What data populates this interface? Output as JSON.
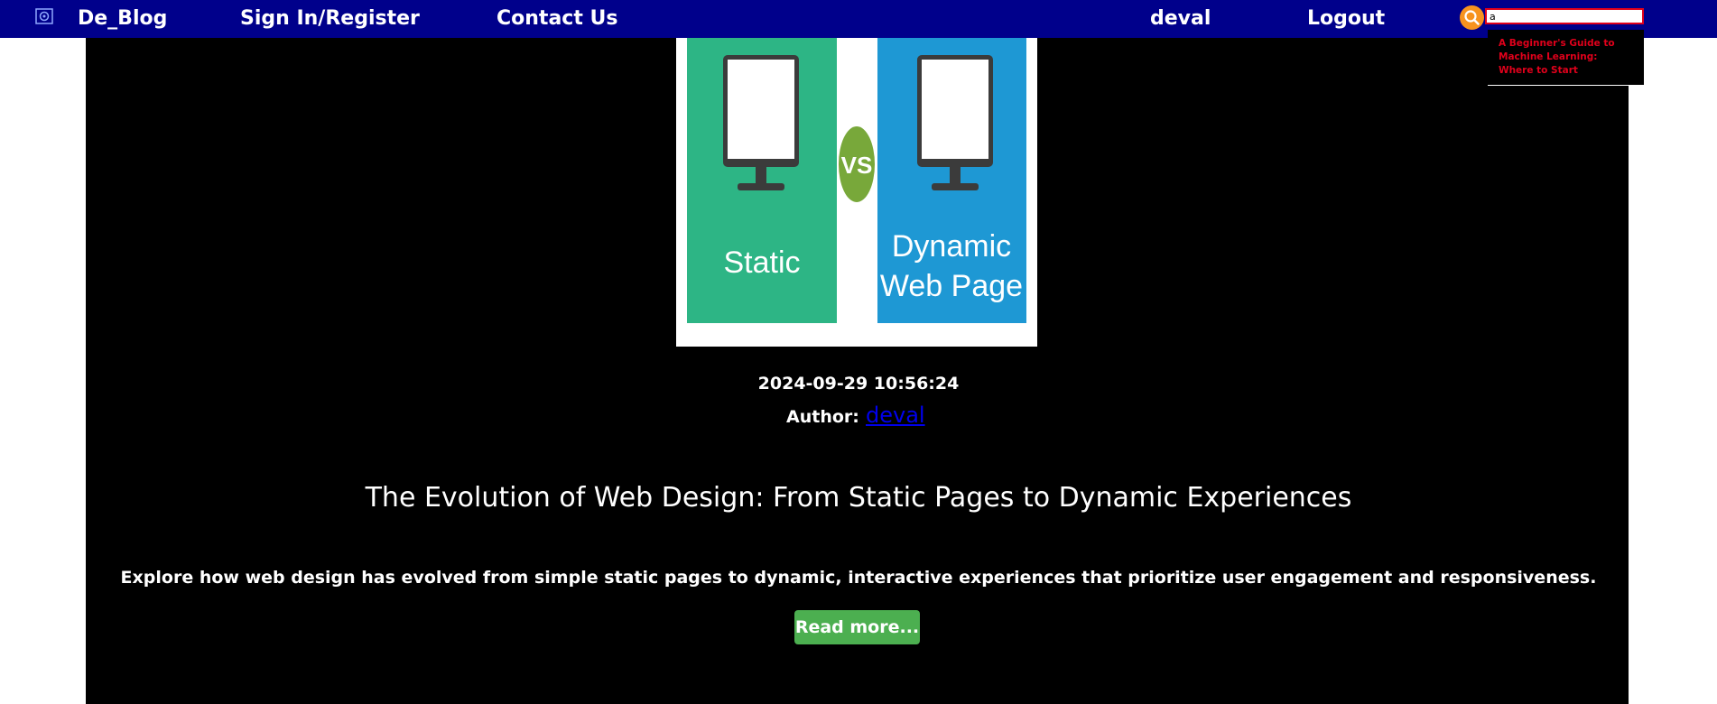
{
  "nav": {
    "brand": "De_Blog",
    "sign_in_register": "Sign In/Register",
    "contact_us": "Contact Us",
    "username": "deval",
    "logout": "Logout",
    "logo_icon": "blog-logo-icon"
  },
  "search": {
    "value": "a",
    "button_icon": "search-icon",
    "suggestions": [
      "A Beginner's Guide to Machine Learning: Where to Start"
    ]
  },
  "post": {
    "image": {
      "left_label": "Static",
      "vs_label": "VS",
      "right_label_line1": "Dynamic",
      "right_label_line2": "Web Page"
    },
    "date": "2024-09-29 10:56:24",
    "author_label": "Author:",
    "author_name": "deval",
    "title": "The Evolution of Web Design: From Static Pages to Dynamic Experiences",
    "summary": "Explore how web design has evolved from simple static pages to dynamic, interactive experiences that prioritize user engagement and responsiveness.",
    "read_more": "Read more..."
  },
  "colors": {
    "navbar": "#00008b",
    "content_bg": "#000000",
    "search_button": "#f7931e",
    "search_border": "#e0001b",
    "suggestion_text": "#e0001b",
    "read_more_bg": "#4caf50",
    "author_link": "#0000ee",
    "image_left_panel": "#2db585",
    "image_right_panel": "#1e98d4",
    "image_vs_badge": "#78a83a"
  }
}
